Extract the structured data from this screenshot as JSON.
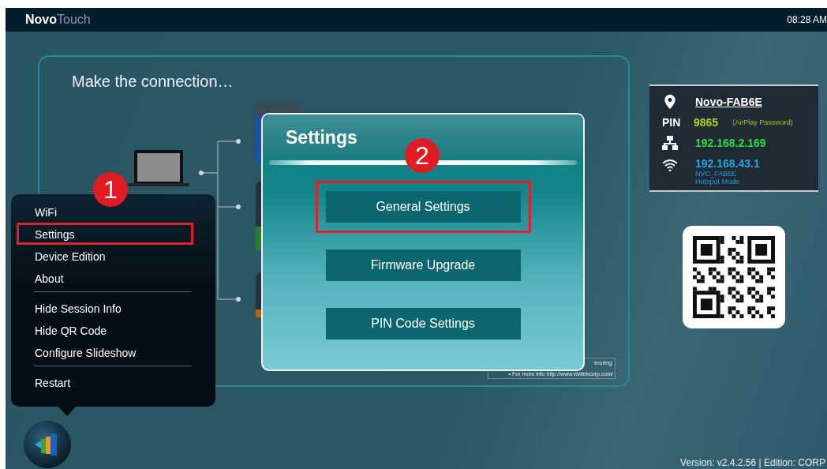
{
  "top_bar": {
    "brand_bold": "Novo",
    "brand_light": "Touch",
    "time": "08:28 AM"
  },
  "connection_card": {
    "title": "Make the connection…",
    "tip_lines": [
      "irroring.",
      "• For more info http://www.vivitekcorp.com/"
    ]
  },
  "session_info": {
    "device_name": "Novo-FAB6E",
    "pin_label": "PIN",
    "pin": "9865",
    "pin_note": "(AirPlay Password)",
    "lan_ip": "192.168.2.169",
    "wifi_ip": "192.168.43.1",
    "ssid": "NVC_FAB6E",
    "wifi_mode": "Hotspot Mode"
  },
  "menu": {
    "groups": [
      [
        {
          "label": "WiFi",
          "highlighted": false
        },
        {
          "label": "Settings",
          "highlighted": true
        },
        {
          "label": "Device Edition",
          "highlighted": false
        },
        {
          "label": "About",
          "highlighted": false
        }
      ],
      [
        {
          "label": "Hide Session Info",
          "highlighted": false
        },
        {
          "label": "Hide QR Code",
          "highlighted": false
        },
        {
          "label": "Configure Slideshow",
          "highlighted": false
        }
      ],
      [
        {
          "label": "Restart",
          "highlighted": false
        }
      ]
    ]
  },
  "settings_dialog": {
    "title": "Settings",
    "buttons": [
      {
        "label": "General Settings",
        "highlighted": true
      },
      {
        "label": "Firmware Upgrade",
        "highlighted": false
      },
      {
        "label": "PIN Code Settings",
        "highlighted": false
      }
    ]
  },
  "callouts": [
    {
      "label": "1"
    },
    {
      "label": "2"
    }
  ],
  "footer": {
    "version": "Version:  v2.4.2.56 | Edition: CORP"
  }
}
